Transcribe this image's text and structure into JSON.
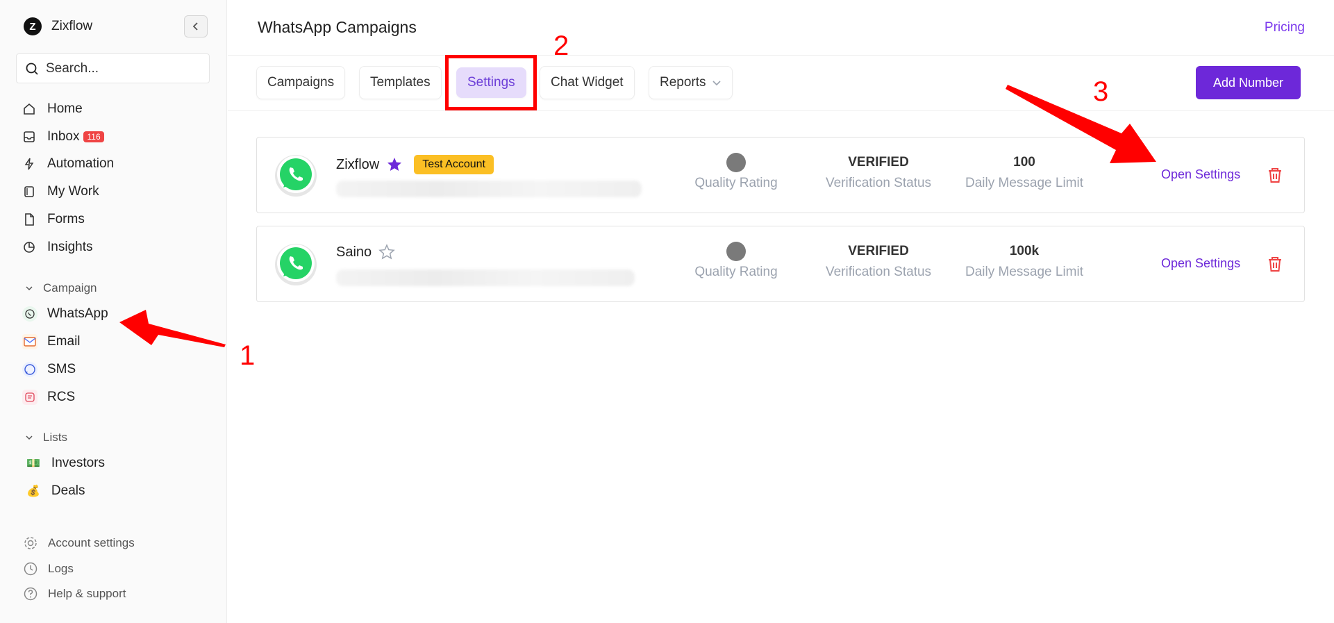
{
  "app": {
    "name": "Zixflow",
    "logo_letter": "Z"
  },
  "search": {
    "placeholder": "Search..."
  },
  "nav": [
    {
      "label": "Home",
      "icon": "home-icon"
    },
    {
      "label": "Inbox",
      "icon": "inbox-icon",
      "badge": "116"
    },
    {
      "label": "Automation",
      "icon": "lightning-icon"
    },
    {
      "label": "My Work",
      "icon": "mywork-icon"
    },
    {
      "label": "Forms",
      "icon": "file-icon"
    },
    {
      "label": "Insights",
      "icon": "pie-chart-icon"
    }
  ],
  "campaign_section": {
    "title": "Campaign",
    "items": [
      {
        "label": "WhatsApp"
      },
      {
        "label": "Email"
      },
      {
        "label": "SMS"
      },
      {
        "label": "RCS"
      }
    ]
  },
  "lists_section": {
    "title": "Lists",
    "items": [
      {
        "label": "Investors",
        "emoji": "💵"
      },
      {
        "label": "Deals",
        "emoji": "💰"
      }
    ]
  },
  "footer": [
    {
      "label": "Account settings"
    },
    {
      "label": "Logs"
    },
    {
      "label": "Help & support"
    }
  ],
  "header": {
    "title": "WhatsApp Campaigns",
    "pricing": "Pricing"
  },
  "tabs": [
    {
      "label": "Campaigns"
    },
    {
      "label": "Templates"
    },
    {
      "label": "Settings",
      "active": true
    },
    {
      "label": "Chat Widget"
    },
    {
      "label": "Reports",
      "has_dropdown": true
    }
  ],
  "add_number_label": "Add Number",
  "accounts": [
    {
      "name": "Zixflow",
      "starred": true,
      "badge": "Test Account",
      "quality_label": "Quality Rating",
      "verification": "VERIFIED",
      "verification_label": "Verification Status",
      "limit": "100",
      "limit_label": "Daily Message Limit",
      "action": "Open Settings"
    },
    {
      "name": "Saino",
      "starred": false,
      "quality_label": "Quality Rating",
      "verification": "VERIFIED",
      "verification_label": "Verification Status",
      "limit": "100k",
      "limit_label": "Daily Message Limit",
      "action": "Open Settings"
    }
  ],
  "annotations": {
    "step1": "1",
    "step2": "2",
    "step3": "3"
  },
  "colors": {
    "accent": "#6d28d9",
    "badge_red": "#ef4444",
    "test_badge": "#fbbf24",
    "annotation": "#ff0000",
    "whatsapp": "#25d366"
  }
}
